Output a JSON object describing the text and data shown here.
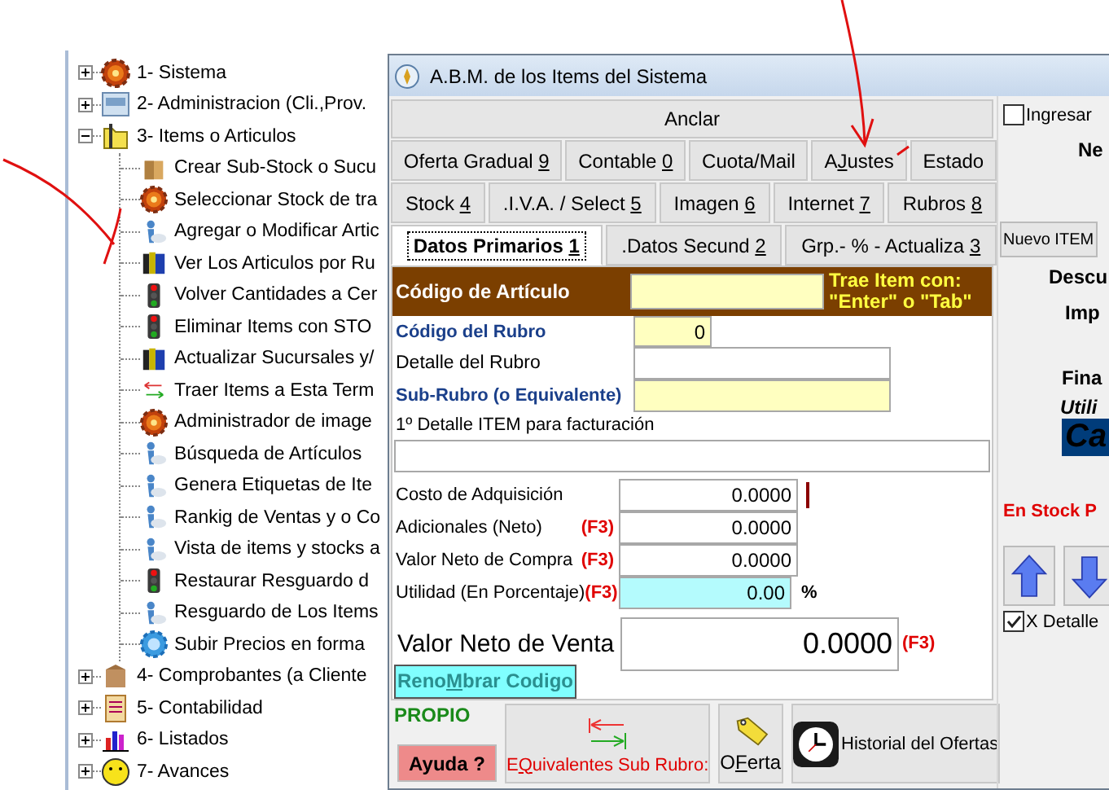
{
  "tree": {
    "items": [
      {
        "label": "1- Sistema",
        "kind": "gear",
        "expanded": false
      },
      {
        "label": "2- Administracion (Cli.,Prov.",
        "kind": "panel",
        "expanded": false
      },
      {
        "label": "3- Items o Articulos",
        "kind": "folder",
        "expanded": true,
        "children": [
          {
            "label": "Crear Sub-Stock o Sucu",
            "kind": "box"
          },
          {
            "label": "Seleccionar Stock de tra",
            "kind": "gear"
          },
          {
            "label": "Agregar o Modificar Artic",
            "kind": "person"
          },
          {
            "label": "Ver Los Articulos por Ru",
            "kind": "books"
          },
          {
            "label": "Volver Cantidades a Cer",
            "kind": "light"
          },
          {
            "label": "Eliminar Items con STO",
            "kind": "light"
          },
          {
            "label": "Actualizar Sucursales y/",
            "kind": "books"
          },
          {
            "label": "Traer Items a Esta Term",
            "kind": "arrows"
          },
          {
            "label": "Administrador de image",
            "kind": "gear"
          },
          {
            "label": "Búsqueda de Artículos",
            "kind": "person"
          },
          {
            "label": "Genera Etiquetas de Ite",
            "kind": "person"
          },
          {
            "label": "Rankig de Ventas y o Co",
            "kind": "person"
          },
          {
            "label": "Vista de items y stocks a",
            "kind": "person"
          },
          {
            "label": "Restaurar Resguardo d",
            "kind": "light"
          },
          {
            "label": "Resguardo de Los Items",
            "kind": "person"
          },
          {
            "label": "Subir Precios en forma",
            "kind": "bluegear"
          }
        ]
      },
      {
        "label": "4- Comprobantes (a Cliente",
        "kind": "package",
        "expanded": false
      },
      {
        "label": "5- Contabilidad",
        "kind": "ledger",
        "expanded": false
      },
      {
        "label": "6- Listados",
        "kind": "chart",
        "expanded": false
      },
      {
        "label": "7- Avances",
        "kind": "smiley",
        "expanded": false
      }
    ]
  },
  "dialog": {
    "title": "A.B.M. de los Items del Sistema",
    "anchor_button": "Anclar",
    "tab_rows": [
      [
        {
          "parts": [
            {
              "text": "Oferta Gradual ",
              "underlined": false
            },
            {
              "text": "9",
              "underlined": true
            }
          ],
          "selected": false
        },
        {
          "parts": [
            {
              "text": "Contable ",
              "underlined": false
            },
            {
              "text": "0",
              "underlined": true
            }
          ],
          "selected": false
        },
        {
          "parts": [
            {
              "text": "Cuota/Mail",
              "underlined": false
            }
          ],
          "selected": false
        },
        {
          "parts": [
            {
              "text": "A",
              "underlined": false
            },
            {
              "text": "J",
              "underlined": true
            },
            {
              "text": "ustes",
              "underlined": false
            }
          ],
          "selected": false
        },
        {
          "parts": [
            {
              "text": "Estado",
              "underlined": false
            }
          ],
          "selected": false
        }
      ],
      [
        {
          "parts": [
            {
              "text": "Stock ",
              "underlined": false
            },
            {
              "text": "4",
              "underlined": true
            }
          ],
          "selected": false
        },
        {
          "parts": [
            {
              "text": ".I.V.A. / Select ",
              "underlined": false
            },
            {
              "text": "5",
              "underlined": true
            }
          ],
          "selected": false
        },
        {
          "parts": [
            {
              "text": "Imagen ",
              "underlined": false
            },
            {
              "text": "6",
              "underlined": true
            }
          ],
          "selected": false
        },
        {
          "parts": [
            {
              "text": "Internet ",
              "underlined": false
            },
            {
              "text": "7",
              "underlined": true
            }
          ],
          "selected": false
        },
        {
          "parts": [
            {
              "text": "Rubros ",
              "underlined": false
            },
            {
              "text": "8",
              "underlined": true
            }
          ],
          "selected": false
        }
      ],
      [
        {
          "parts": [
            {
              "text": "Datos Primarios ",
              "underlined": false
            },
            {
              "text": "1",
              "underlined": true
            }
          ],
          "selected": true
        },
        {
          "parts": [
            {
              "text": ".Datos Secund ",
              "underlined": false
            },
            {
              "text": "2",
              "underlined": true
            }
          ],
          "selected": false
        },
        {
          "parts": [
            {
              "text": "Grp.- % - Actualiza ",
              "underlined": false
            },
            {
              "text": "3",
              "underlined": true
            }
          ],
          "selected": false
        }
      ]
    ],
    "form": {
      "article_code": {
        "label": "Código de Artículo",
        "hint_lines": [
          "Trae Item con:",
          "\"Enter\" o \"Tab\""
        ]
      },
      "rubro_code": {
        "label": "Código del Rubro",
        "value": "0"
      },
      "rubro_detail": {
        "label": "Detalle del Rubro"
      },
      "sub_rubro": {
        "label": "Sub-Rubro (o Equivalente)"
      },
      "item_detail": {
        "label": "1º Detalle ITEM para facturación"
      },
      "costs": [
        {
          "label": "Costo de Adquisición",
          "value": "0.0000",
          "kind": "marker"
        },
        {
          "label": "Adicionales (Neto)",
          "shortcut": "(F3)",
          "value": "0.0000",
          "kind": "plain"
        },
        {
          "label": "Valor Neto de Compra",
          "shortcut": "(F3)",
          "value": "0.0000",
          "kind": "plain"
        },
        {
          "label": "Utilidad (En Porcentaje)",
          "shortcut": "(F3)",
          "value": "0.00",
          "unit": "%",
          "kind": "percent"
        }
      ],
      "sale_value": {
        "label": "Valor Neto de Venta",
        "value": "0.0000",
        "shortcut": "(F3)"
      },
      "rename_button": [
        {
          "text": "Reno",
          "underlined": false
        },
        {
          "text": "M",
          "underlined": true
        },
        {
          "text": "brar Codigo",
          "underlined": false
        }
      ]
    },
    "bottom": {
      "origin": "PROPIO",
      "help_button": "Ayuda ?",
      "buttons": [
        {
          "kind": "equivalents",
          "parts": [
            {
              "text": "E",
              "underlined": false
            },
            {
              "text": "Q",
              "underlined": true
            },
            {
              "text": "uivalentes Sub Rubro:",
              "underlined": false
            }
          ]
        },
        {
          "kind": "offer",
          "parts": [
            {
              "text": "O",
              "underlined": false
            },
            {
              "text": "F",
              "underlined": true
            },
            {
              "text": "erta",
              "underlined": false
            }
          ]
        },
        {
          "kind": "history",
          "parts": [
            {
              "text": "Historial del Ofertas",
              "underlined": false
            }
          ]
        }
      ]
    },
    "side": [
      {
        "kind": "checkbox",
        "label": "Ingresar",
        "checked": false
      },
      {
        "kind": "label",
        "label": "Ne"
      },
      {
        "kind": "button",
        "label": "Nuevo ITEM"
      },
      {
        "kind": "label",
        "label": "Descu"
      },
      {
        "kind": "label",
        "label": "Imp"
      },
      {
        "kind": "label",
        "label": "Fina"
      },
      {
        "kind": "italic",
        "label": "Utili"
      },
      {
        "kind": "highlight",
        "label": "Ca"
      },
      {
        "kind": "alert",
        "label": "En Stock P"
      },
      {
        "kind": "arrows"
      },
      {
        "kind": "checkbox",
        "label": "X Detalle",
        "checked": true
      }
    ]
  }
}
